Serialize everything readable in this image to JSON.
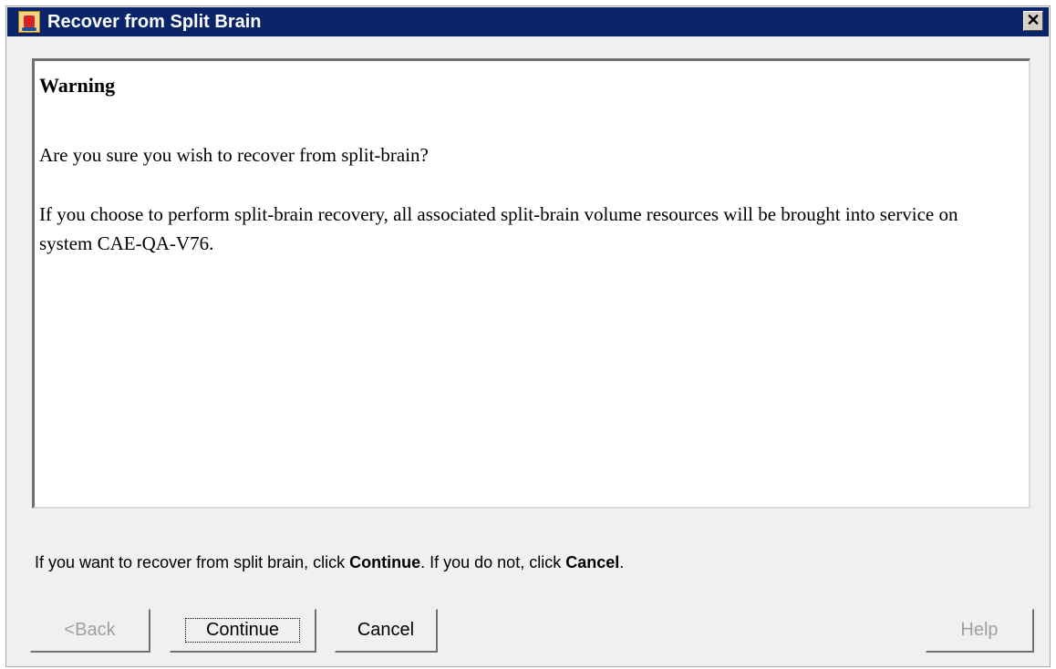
{
  "window": {
    "title": "Recover from Split Brain",
    "close_glyph": "✕",
    "icon": "java-cup-icon"
  },
  "content": {
    "heading": "Warning",
    "question": "Are you sure you wish to recover from split-brain?",
    "details": "If you choose to perform split-brain recovery, all associated split-brain volume resources will be brought into service on system CAE-QA-V76."
  },
  "instruction": {
    "part1": "If you want to recover from split brain, click ",
    "continue_word": "Continue",
    "part2": ". If you do not, click ",
    "cancel_word": "Cancel",
    "part3": "."
  },
  "buttons": {
    "back": "<Back",
    "continue": "Continue",
    "cancel": "Cancel",
    "help": "Help"
  },
  "colors": {
    "titlebar": "#0a246a",
    "dialog_bg": "#f0f0f0",
    "disabled_text": "#a0a0a0"
  }
}
